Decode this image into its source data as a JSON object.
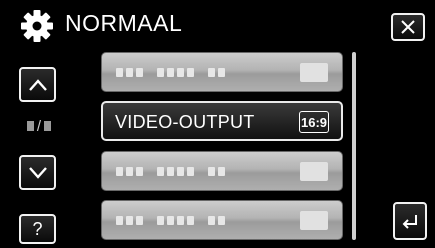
{
  "header": {
    "title": "NORMAAL",
    "icon": "gear-icon",
    "close_icon": "close-icon"
  },
  "nav": {
    "up_icon": "chevron-up-icon",
    "down_icon": "chevron-down-icon",
    "page_separator": "/",
    "help_label": "?",
    "back_icon": "return-icon"
  },
  "menu": {
    "items": [
      {
        "label": "",
        "state": "blurred"
      },
      {
        "label": "VIDEO-OUTPUT",
        "value": "16:9",
        "state": "selected"
      },
      {
        "label": "",
        "state": "blurred"
      },
      {
        "label": "",
        "state": "blurred"
      }
    ]
  },
  "colors": {
    "background": "#000000",
    "item_light": "#c4c4c4",
    "item_selected": "#1e1e1e",
    "text": "#ffffff"
  }
}
